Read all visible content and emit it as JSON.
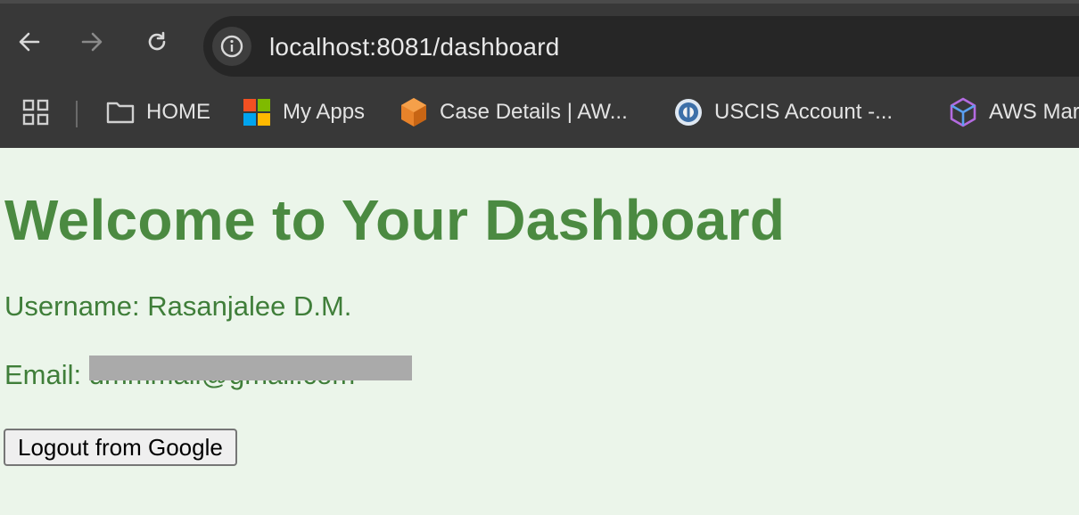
{
  "browser": {
    "url": "localhost:8081/dashboard",
    "bookmarks": [
      {
        "label": "HOME",
        "icon": "folder-icon"
      },
      {
        "label": "My Apps",
        "icon": "microsoft-icon"
      },
      {
        "label": "Case Details | AW...",
        "icon": "aws-box-icon"
      },
      {
        "label": "USCIS Account -...",
        "icon": "uscis-seal-icon"
      },
      {
        "label": "AWS Mar",
        "icon": "aws-cube-icon"
      }
    ]
  },
  "page": {
    "title": "Welcome to Your Dashboard",
    "username_line": "Username: Rasanjalee D.M.",
    "email_label": "Email:",
    "email_value": "dmmmail@gmail.com",
    "logout_label": "Logout from Google",
    "colors": {
      "heading": "#4b8a41",
      "text": "#3f7e39",
      "background": "#ebf5ea"
    }
  }
}
